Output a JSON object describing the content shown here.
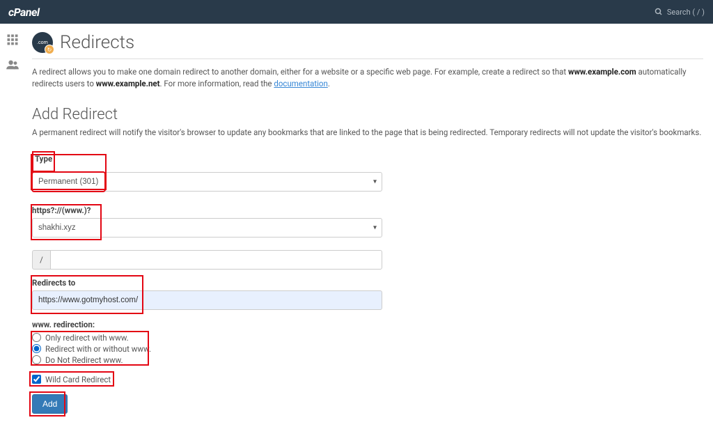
{
  "topbar": {
    "logo": "cPanel",
    "search_text": "Search ( / )"
  },
  "page": {
    "title": "Redirects",
    "intro_1": "A redirect allows you to make one domain redirect to another domain, either for a website or a specific web page. For example, create a redirect so that ",
    "intro_bold1": "www.example.com",
    "intro_2": " automatically redirects users to ",
    "intro_bold2": "www.example.net",
    "intro_3": ". For more information, read the ",
    "doclink": "documentation",
    "intro_4": "."
  },
  "addRedirect": {
    "title": "Add Redirect",
    "desc": "A permanent redirect will notify the visitor's browser to update any bookmarks that are linked to the page that is being redirected. Temporary redirects will not update the visitor's bookmarks.",
    "type": {
      "label": "Type",
      "value": "Permanent (301)"
    },
    "domain": {
      "label": "https?://(www.)?",
      "value": "shakhi.xyz"
    },
    "path": {
      "prefix": "/",
      "value": ""
    },
    "redirectsTo": {
      "label": "Redirects to",
      "value": "https://www.gotmyhost.com/"
    },
    "wwwRedirection": {
      "label": "www. redirection:",
      "options": [
        "Only redirect with www.",
        "Redirect with or without www.",
        "Do Not Redirect www."
      ],
      "selected": 1
    },
    "wildcard": {
      "label": "Wild Card Redirect",
      "checked": true
    },
    "addButton": "Add"
  }
}
